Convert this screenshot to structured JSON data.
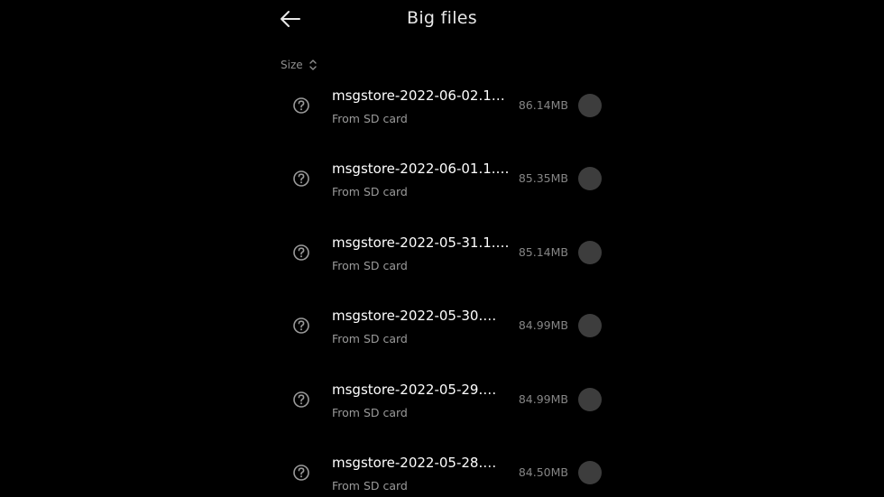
{
  "header": {
    "title": "Big files",
    "back_icon": "arrow-left-icon"
  },
  "sort": {
    "label": "Size",
    "icon": "sort-chevrons-icon"
  },
  "files": [
    {
      "name": "msgstore-2022-06-02.1…",
      "source": "From SD card",
      "size": "86.14MB",
      "icon": "unknown-file-icon",
      "selected": false
    },
    {
      "name": "msgstore-2022-06-01.1.…",
      "source": "From SD card",
      "size": "85.35MB",
      "icon": "unknown-file-icon",
      "selected": false
    },
    {
      "name": "msgstore-2022-05-31.1.…",
      "source": "From SD card",
      "size": "85.14MB",
      "icon": "unknown-file-icon",
      "selected": false
    },
    {
      "name": "msgstore-2022-05-30.…",
      "source": "From SD card",
      "size": "84.99MB",
      "icon": "unknown-file-icon",
      "selected": false
    },
    {
      "name": "msgstore-2022-05-29.…",
      "source": "From SD card",
      "size": "84.99MB",
      "icon": "unknown-file-icon",
      "selected": false
    },
    {
      "name": "msgstore-2022-05-28.…",
      "source": "From SD card",
      "size": "84.50MB",
      "icon": "unknown-file-icon",
      "selected": false
    }
  ],
  "colors": {
    "background": "#000000",
    "text_primary": "#ffffff",
    "text_secondary": "#9a9a9a",
    "checkbox": "#3d3d3d"
  }
}
